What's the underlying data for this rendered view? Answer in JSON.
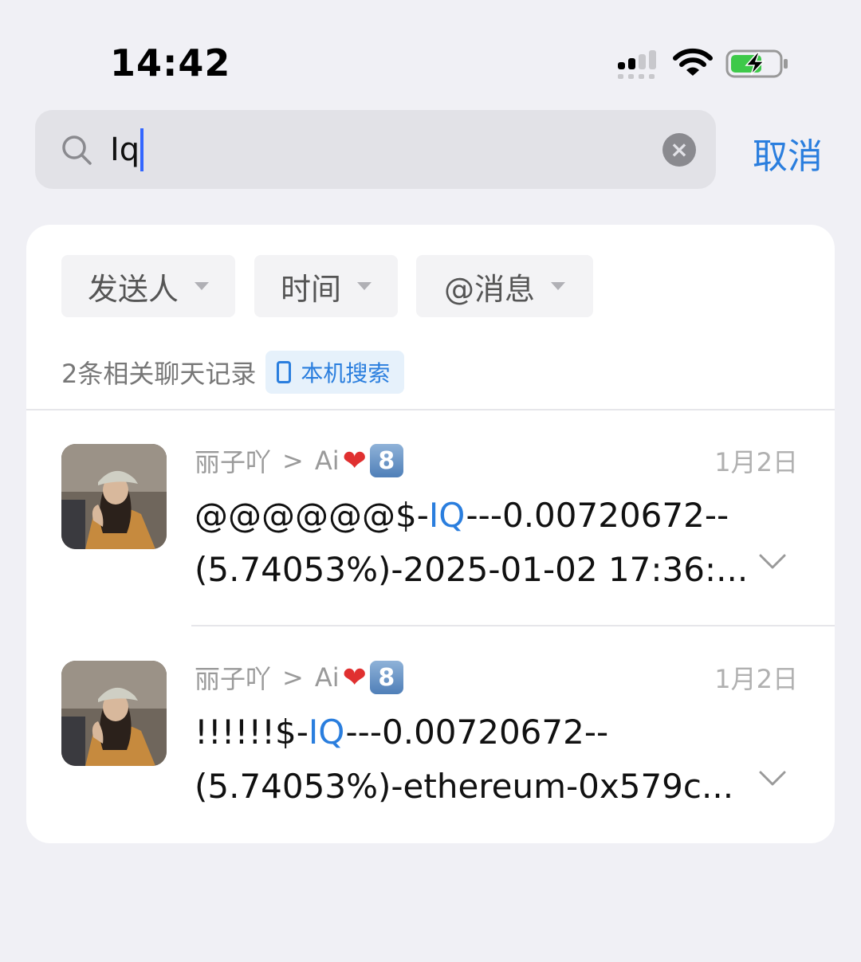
{
  "status_bar": {
    "time": "14:42"
  },
  "search": {
    "query": "Iq",
    "cancel_label": "取消"
  },
  "filters": [
    {
      "label": "发送人"
    },
    {
      "label": "时间"
    },
    {
      "label": "@消息"
    }
  ],
  "results_summary": {
    "count_text": "2条相关聊天记录",
    "local_search_label": "本机搜索"
  },
  "results": [
    {
      "sender": "丽子吖",
      "separator": ">",
      "chat": "Ai",
      "badge": "8",
      "date": "1月2日",
      "line1_prefix": "@@@@@@$-",
      "highlight": "IQ",
      "line1_suffix": "---0.00720672--",
      "line2": "(5.74053%)-2025-01-02 17:36:..."
    },
    {
      "sender": "丽子吖",
      "separator": ">",
      "chat": "Ai",
      "badge": "8",
      "date": "1月2日",
      "line1_prefix": "!!!!!!$-",
      "highlight": "IQ",
      "line1_suffix": "---0.00720672--",
      "line2": "(5.74053%)-ethereum-0x579c..."
    }
  ],
  "colors": {
    "accent": "#2a7ede",
    "background": "#f0f0f5",
    "card": "#ffffff"
  },
  "icons": [
    "signal-icon",
    "wifi-icon",
    "battery-charging-icon",
    "search-icon",
    "clear-icon",
    "phone-icon",
    "chevron-down-icon"
  ]
}
